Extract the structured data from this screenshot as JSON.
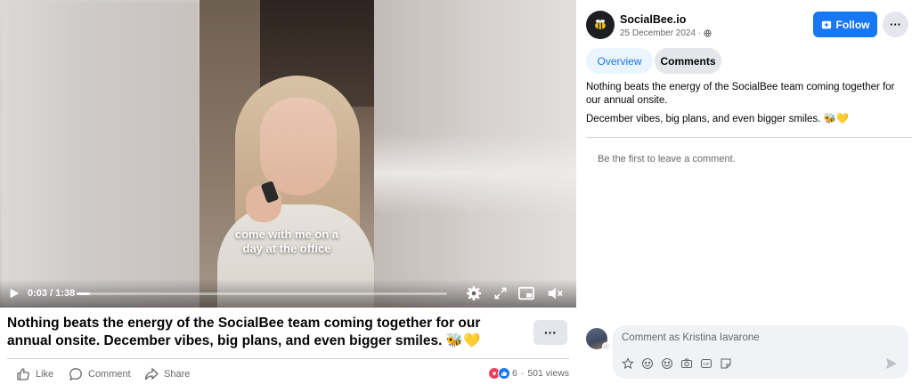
{
  "video": {
    "caption_line1": "come with me on a",
    "caption_line2": "day at the office",
    "timecode": "0:03 / 1:38",
    "progress_fraction": 0.035
  },
  "post": {
    "caption": "Nothing beats the energy of the SocialBee team coming together for our annual onsite. December vibes, big plans, and even bigger smiles. 🐝💛",
    "more_label": "···",
    "actions": {
      "like": "Like",
      "comment": "Comment",
      "share": "Share"
    },
    "reaction_count": "6",
    "separator": "·",
    "views": "501 views"
  },
  "panel": {
    "page_name": "SocialBee.io",
    "date": "25 December 2024 ·",
    "follow_label": "Follow",
    "more_label": "···",
    "tabs": [
      {
        "label": "Overview",
        "active": true
      },
      {
        "label": "Comments",
        "active": false
      }
    ],
    "text_line1": "Nothing beats the energy of the SocialBee team coming together for our annual onsite.",
    "text_line2": "December vibes, big plans, and even bigger smiles. 🐝💛",
    "empty_comments": "Be the first to leave a comment.",
    "comment_placeholder": "Comment as Kristina Iavarone"
  },
  "colors": {
    "accent": "#1877f2",
    "heart": "#f33e58",
    "muted_text": "#65676b",
    "bubble": "#f0f2f5"
  },
  "icons": {
    "play": "play-icon",
    "gear": "gear-icon",
    "expand": "expand-icon",
    "pip": "picture-in-picture-icon",
    "volume": "volume-icon",
    "like": "thumbs-up-icon",
    "comment": "comment-bubble-icon",
    "share": "share-arrow-icon",
    "globe": "globe-icon",
    "follow": "follow-page-icon",
    "send": "send-icon"
  }
}
